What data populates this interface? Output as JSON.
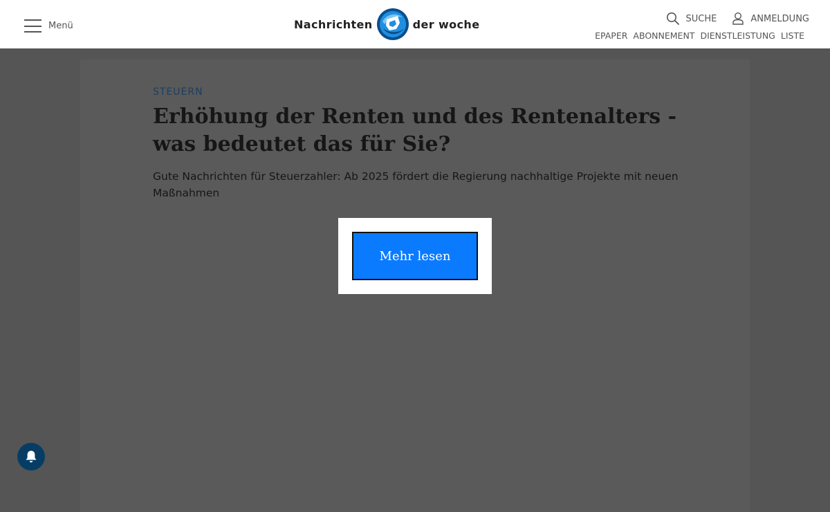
{
  "header": {
    "menu_label": "Menü",
    "logo_left": "Nachrichten",
    "logo_right": "der woche",
    "search_label": "SUCHE",
    "login_label": "ANMELDUNG",
    "subnav": [
      "EPAPER",
      "ABONNEMENT",
      "DIENSTLEISTUNG",
      "LISTE"
    ]
  },
  "article": {
    "kicker": "STEUERN",
    "headline": "Erhöhung der Renten und des Rentenalters - was bedeutet das für Sie?",
    "teaser": "Gute Nachrichten für Steuerzahler: Ab 2025 fördert die Regierung nachhaltige Projekte mit neuen Maßnahmen",
    "cta_label": "Mehr lesen"
  },
  "icons": {
    "menu": "hamburger-icon",
    "logo": "globe-icon",
    "search": "search-icon",
    "user": "user-icon",
    "notification": "bell-icon"
  },
  "colors": {
    "overlay_background": "#555555",
    "kicker": "#1d3d5e",
    "cta_button": "#0a7bff",
    "notification_button": "#073d64",
    "logo_blue": "#1f8fe0"
  }
}
